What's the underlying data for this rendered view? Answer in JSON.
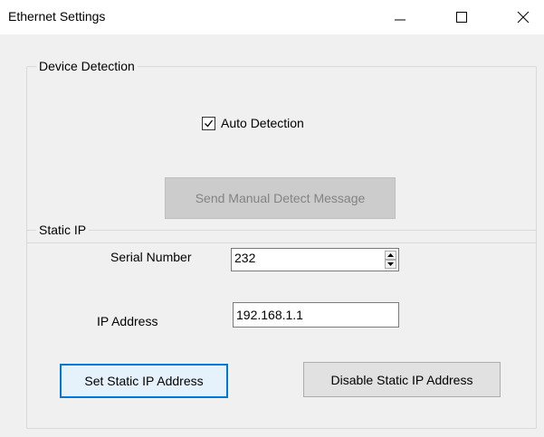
{
  "window": {
    "title": "Ethernet Settings",
    "controls": {
      "minimize": "minimize-icon",
      "maximize": "maximize-icon",
      "close": "close-icon"
    }
  },
  "device_detection": {
    "group_label": "Device Detection",
    "auto_detection_label": "Auto Detection",
    "auto_detection_checked": true,
    "manual_detect_button": "Send Manual Detect Message",
    "manual_detect_enabled": false
  },
  "static_ip": {
    "group_label": "Static IP",
    "serial_number_label": "Serial Number",
    "serial_number_value": "232",
    "ip_address_label": "IP Address",
    "ip_address_value": "192.168.1.1",
    "set_button": "Set Static IP Address",
    "disable_button": "Disable Static IP Address"
  },
  "colors": {
    "client_bg": "#f0f0f0",
    "focus_accent": "#0078d7"
  }
}
